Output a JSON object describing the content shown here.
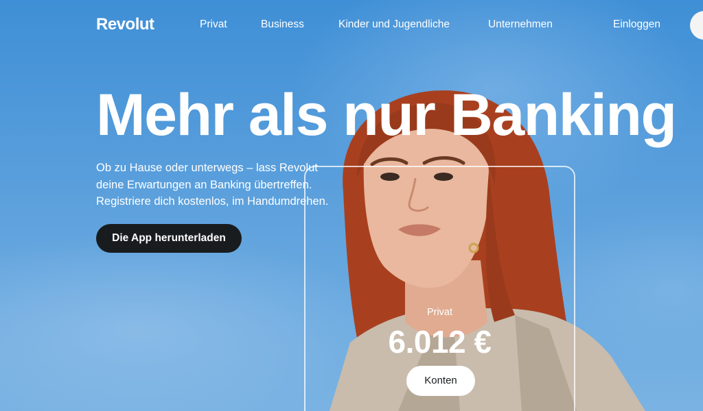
{
  "nav": {
    "logo": "Revolut",
    "links": [
      "Privat",
      "Business",
      "Kinder und Jugendliche",
      "Unternehmen"
    ],
    "login": "Einloggen"
  },
  "hero": {
    "title": "Mehr als nur Banking",
    "subtitle_lines": [
      "Ob zu Hause oder unterwegs – lass Revolut",
      "deine Erwartungen an Banking übertreffen.",
      "Registriere dich kostenlos, im Handumdrehen."
    ],
    "cta": "Die App herunterladen"
  },
  "card": {
    "label": "Privat",
    "amount": "6.012 €",
    "button": "Konten"
  },
  "colors": {
    "sky": "#4a94d8",
    "button_dark": "#191c1f",
    "hair": "#a8401f",
    "jacket": "#c9bcac"
  }
}
